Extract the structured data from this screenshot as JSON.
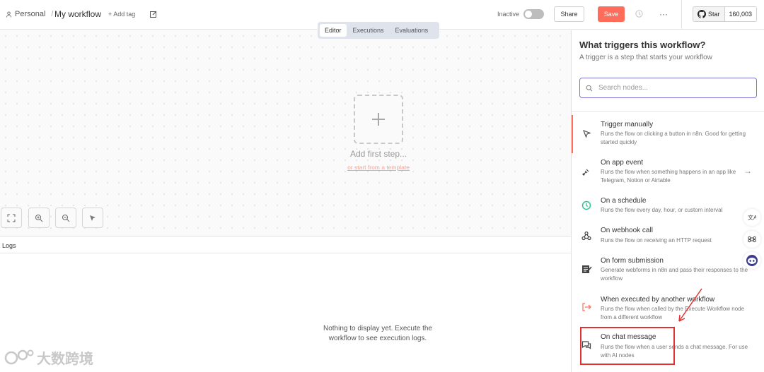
{
  "header": {
    "breadcrumb_project": "Personal",
    "workflow_title": "My workflow",
    "add_tag": "+ Add tag",
    "status_label": "Inactive",
    "share_label": "Share",
    "save_label": "Save",
    "more_label": "···",
    "github_star": "Star",
    "github_count": "160,003"
  },
  "tabs": [
    "Editor",
    "Executions",
    "Evaluations"
  ],
  "canvas": {
    "add_first_step": "Add first step...",
    "or_template": "or start from a template"
  },
  "logs": {
    "title": "Logs",
    "empty_line1": "Nothing to display yet. Execute the",
    "empty_line2": "workflow to see execution logs."
  },
  "panel": {
    "title": "What triggers this workflow?",
    "subtitle": "A trigger is a step that starts your workflow",
    "search_placeholder": "Search nodes...",
    "items": [
      {
        "title": "Trigger manually",
        "desc": "Runs the flow on clicking a button in n8n. Good for getting started quickly",
        "icon": "cursor-icon"
      },
      {
        "title": "On app event",
        "desc": "Runs the flow when something happens in an app like Telegram, Notion or Airtable",
        "icon": "satellite-icon"
      },
      {
        "title": "On a schedule",
        "desc": "Runs the flow every day, hour, or custom interval",
        "icon": "clock-icon"
      },
      {
        "title": "On webhook call",
        "desc": "Runs the flow on receiving an HTTP request",
        "icon": "webhook-icon"
      },
      {
        "title": "On form submission",
        "desc": "Generate webforms in n8n and pass their responses to the workflow",
        "icon": "form-icon"
      },
      {
        "title": "When executed by another workflow",
        "desc": "Runs the flow when called by the Execute Workflow node from a different workflow",
        "icon": "sign-in-icon"
      },
      {
        "title": "On chat message",
        "desc": "Runs the flow when a user sends a chat message. For use with AI nodes",
        "icon": "chat-icon"
      }
    ]
  },
  "watermark": "大数跨境",
  "colors": {
    "accent": "#ff6d5a",
    "search_border": "#7b74d4",
    "highlight": "#e03131"
  }
}
